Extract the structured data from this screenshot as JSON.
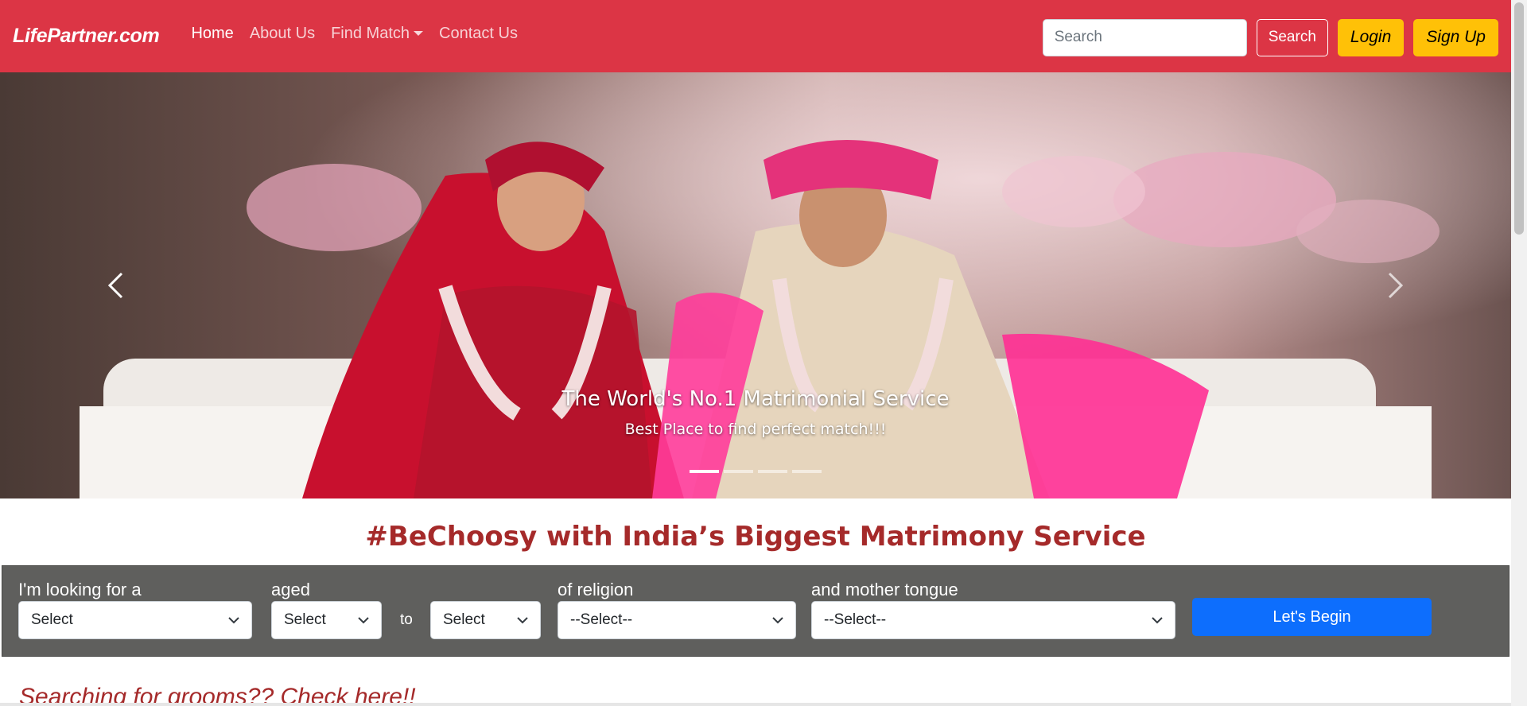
{
  "navbar": {
    "brand": "LifePartner.com",
    "links": [
      {
        "label": "Home",
        "active": true
      },
      {
        "label": "About Us",
        "active": false
      },
      {
        "label": "Find Match",
        "active": false,
        "dropdown": true
      },
      {
        "label": "Contact Us",
        "active": false
      }
    ],
    "search_placeholder": "Search",
    "search_button": "Search",
    "login_button": "Login",
    "signup_button": "Sign Up",
    "bg_color": "#dc3545",
    "accent_color": "#ffc107"
  },
  "carousel": {
    "caption_title": "The World's No.1 Matrimonial Service",
    "caption_text": "Best Place to find perfect match!!!",
    "slide_count": 4,
    "active_slide": 1,
    "prev_icon": "chevron-left-icon",
    "next_icon": "chevron-right-icon"
  },
  "tagline": "#BeChoosy with India’s Biggest Matrimony Service",
  "search_form": {
    "looking_label": "I'm looking for a",
    "looking_value": "Select",
    "aged_label": "aged",
    "age_from_value": "Select",
    "to_label": "to",
    "age_to_value": "Select",
    "religion_label": "of religion",
    "religion_value": "--Select--",
    "tongue_label": "and mother tongue",
    "tongue_value": "--Select--",
    "submit_button": "Let's Begin",
    "band_color": "#5f5f5d",
    "button_color": "#0d6efd"
  },
  "grooms_heading": "Searching for grooms?? Check here!!"
}
